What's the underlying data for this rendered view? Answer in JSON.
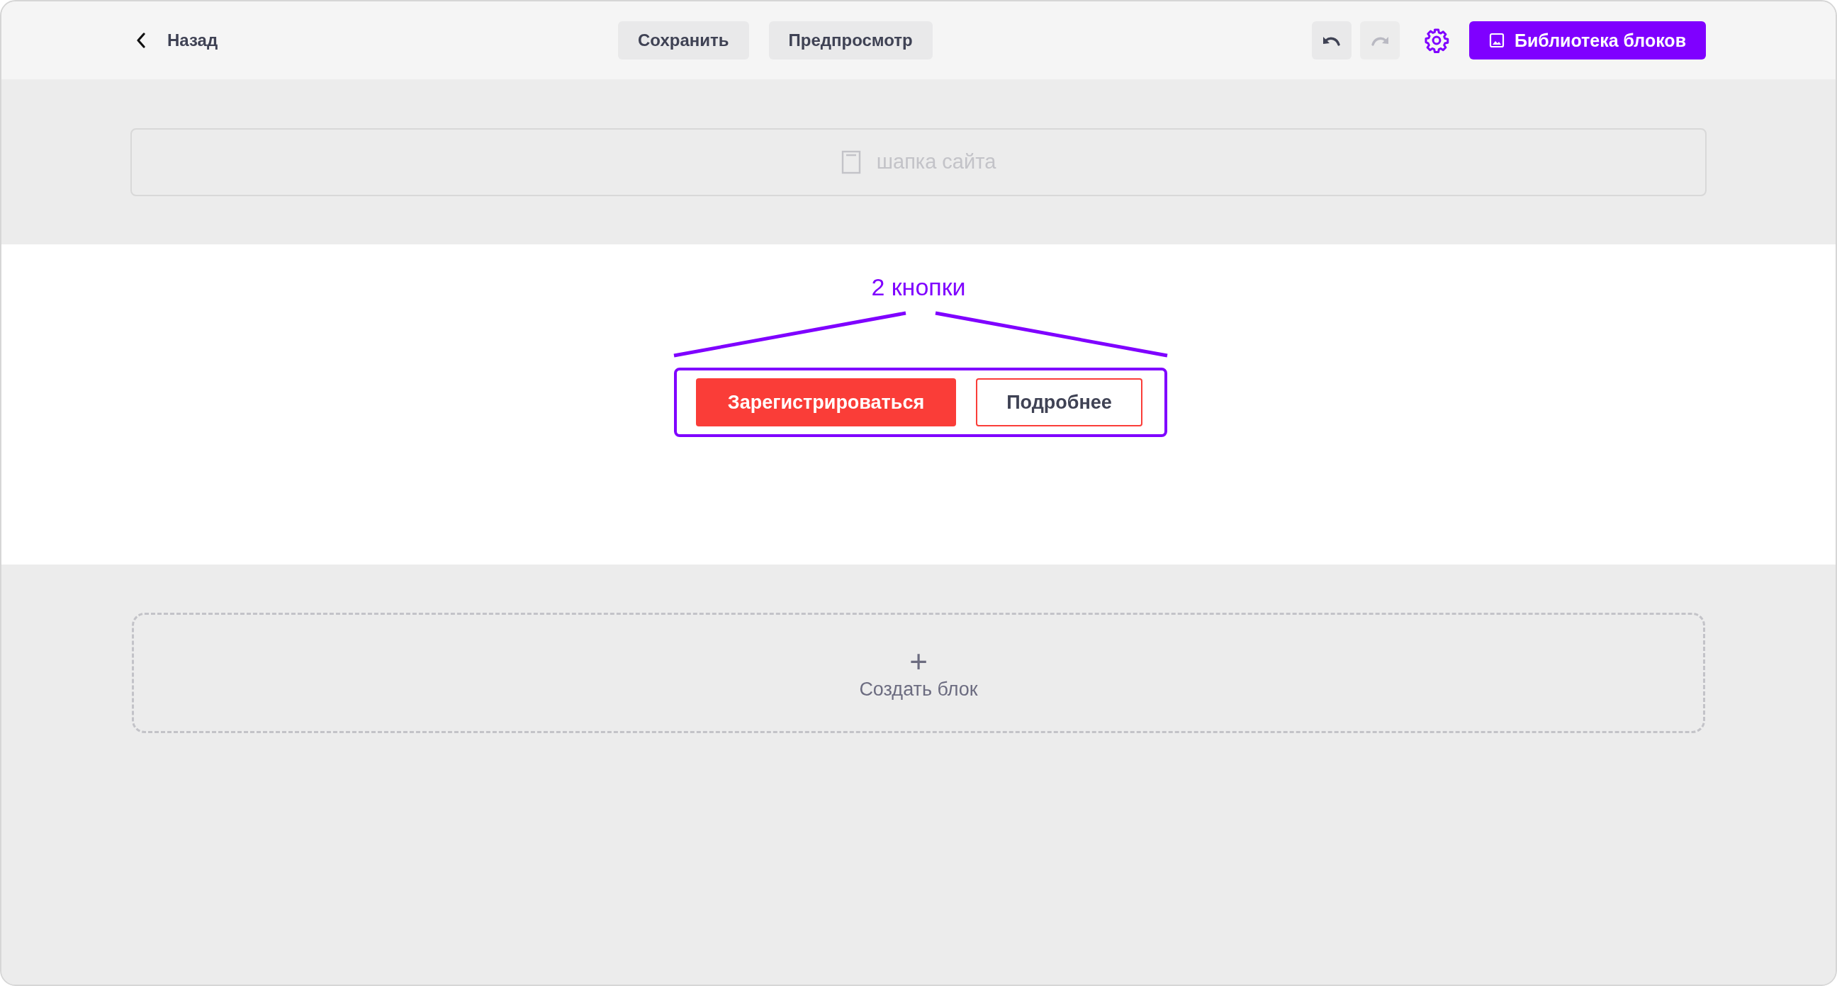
{
  "topbar": {
    "back_label": "Назад",
    "actions": [
      "Сохранить",
      "Предпросмотр"
    ],
    "history": [
      {
        "kind": "undo",
        "disabled": false
      },
      {
        "kind": "redo",
        "disabled": true
      }
    ],
    "library_button": "Библиотека блоков"
  },
  "header_block": {
    "label": "шапка сайта"
  },
  "content_block": {
    "annotation": "2 кнопки",
    "buttons": [
      {
        "label": "Зарегистрироваться",
        "kind": "primary"
      },
      {
        "label": "Подробнее",
        "kind": "outline"
      }
    ]
  },
  "add_block": {
    "icon": "+",
    "label": "Создать блок"
  }
}
